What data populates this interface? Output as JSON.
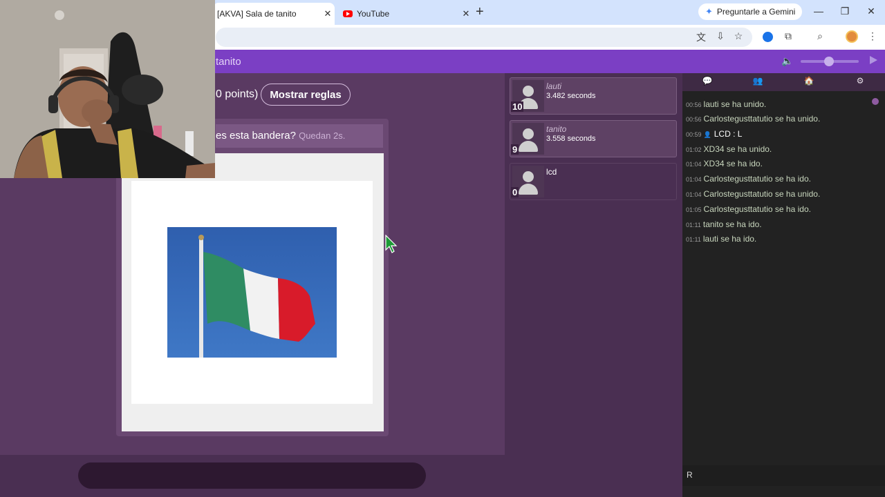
{
  "browser": {
    "tabs": [
      {
        "title": "[AKVA] Sala de tanito",
        "active": true
      },
      {
        "title": "YouTube",
        "active": false
      }
    ],
    "gemini_button": "Preguntarle a Gemini"
  },
  "site": {
    "room_title": "tanito"
  },
  "game": {
    "points_text": "0 points)",
    "rules_button": "Mostrar reglas",
    "question": "es esta bandera?",
    "timer": "Quedan 2s."
  },
  "players": [
    {
      "name": "lauti",
      "time": "3.482 seconds",
      "score": "10"
    },
    {
      "name": "tanito",
      "time": "3.558 seconds",
      "score": "9"
    },
    {
      "name": "lcd",
      "time": "",
      "score": "0"
    }
  ],
  "chat": {
    "messages": [
      {
        "time": "00:56",
        "text": "lauti se ha unido."
      },
      {
        "time": "00:56",
        "text": "Carlostegusttatutio se ha unido."
      },
      {
        "time": "00:59",
        "text": "LCD : L"
      },
      {
        "time": "01:02",
        "text": "XD34 se ha unido."
      },
      {
        "time": "01:04",
        "text": "XD34 se ha ido."
      },
      {
        "time": "01:04",
        "text": "Carlostegusttatutio se ha ido."
      },
      {
        "time": "01:04",
        "text": "Carlostegusttatutio se ha unido."
      },
      {
        "time": "01:05",
        "text": "Carlostegusttatutio se ha ido."
      },
      {
        "time": "01:11",
        "text": "tanito se ha ido."
      },
      {
        "time": "01:11",
        "text": "lauti se ha ido."
      }
    ],
    "input_value": "R"
  },
  "icons": {
    "chat_tab": "speech-bubble-icon",
    "players_tab": "people-icon",
    "rooms_tab": "house-icon",
    "settings_tab": "gear-icon"
  },
  "colors": {
    "header": "#7b3fc4",
    "background": "#5a3a62",
    "chat_bg": "#222222"
  }
}
